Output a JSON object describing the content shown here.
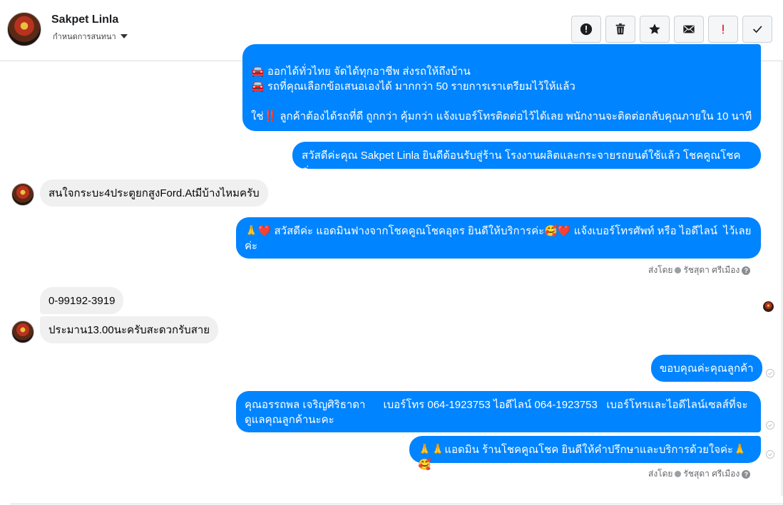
{
  "header": {
    "contact_name": "Sakpet Linla",
    "subtitle": "กำหนดการสนทนา",
    "buttons": [
      {
        "name": "report-button",
        "icon": "alert-circle-icon"
      },
      {
        "name": "delete-button",
        "icon": "trash-icon"
      },
      {
        "name": "star-button",
        "icon": "star-icon"
      },
      {
        "name": "mark-unread-button",
        "icon": "envelope-icon"
      },
      {
        "name": "priority-button",
        "icon": "exclamation-icon"
      },
      {
        "name": "done-button",
        "icon": "checkmark-icon"
      }
    ]
  },
  "messages": {
    "m1": {
      "text": "🚘 ออกได้ทั่วไทย จัดได้ทุกอาชีพ ส่งรถให้ถึงบ้าน\n🚘 รถที่คุณเลือกข้อเสนอเองได้ มากกว่า 50 รายการเราเตรียมไว้ให้แล้ว\n\nใช่‼️ ลูกค้าต้องได้รถที่ดี ถูกกว่า คุ้มกว่า แจ้งเบอร์โทรติดต่อไว้ได้เลย พนักงานจะติดต่อกลับคุณภายใน 10 นาที"
    },
    "m2": {
      "text": "สวัสดีค่ะคุณ Sakpet Linla ยินดีต้อนรับสู่ร้าน โรงงานผลิตและกระจายรถยนต์ใช้แล้ว โชคคูณโชค ค่ะ"
    },
    "m3": {
      "text": "สนใจกระบะ4ประตูยกสูงFord.Atมีบ้างไหมครับ"
    },
    "m4": {
      "text": "🙏❤️ สวัสดีค่ะ แอดมินฟางจากโชคคูณโชคอุดร ยินดีให้บริการค่ะ🥰❤️ แจ้งเบอร์โทรศัพท์ หรือ ไอดีไลน์  ไว้เลยค่ะ"
    },
    "m5": {
      "text": "0-99192-3919"
    },
    "m6": {
      "text": "ประมาน13.00นะครับสะดวกรับสาย"
    },
    "m7": {
      "text": "ขอบคุณค่ะคุณลูกค้า"
    },
    "m8": {
      "text": "คุณอรรถพล เจริญศิริธาดา      เบอร์โทร 064-1923753 ไอดีไลน์ 064-1923753   เบอร์โทรและไอดีไลน์เซลส์ที่จะดูแลคุณลูกค้านะคะ"
    },
    "m9": {
      "text": "🙏🙏แอดมิน ร้านโชคคูณโชค ยินดีให้คำปรึกษาและบริการด้วยใจค่ะ🙏🥰"
    }
  },
  "sent_by": {
    "prefix": "ส่งโดย",
    "agent": "รัชสุดา ศรีเมือง"
  },
  "colors": {
    "outgoing_bubble": "#0084ff",
    "incoming_bubble": "#f0f0f0"
  }
}
